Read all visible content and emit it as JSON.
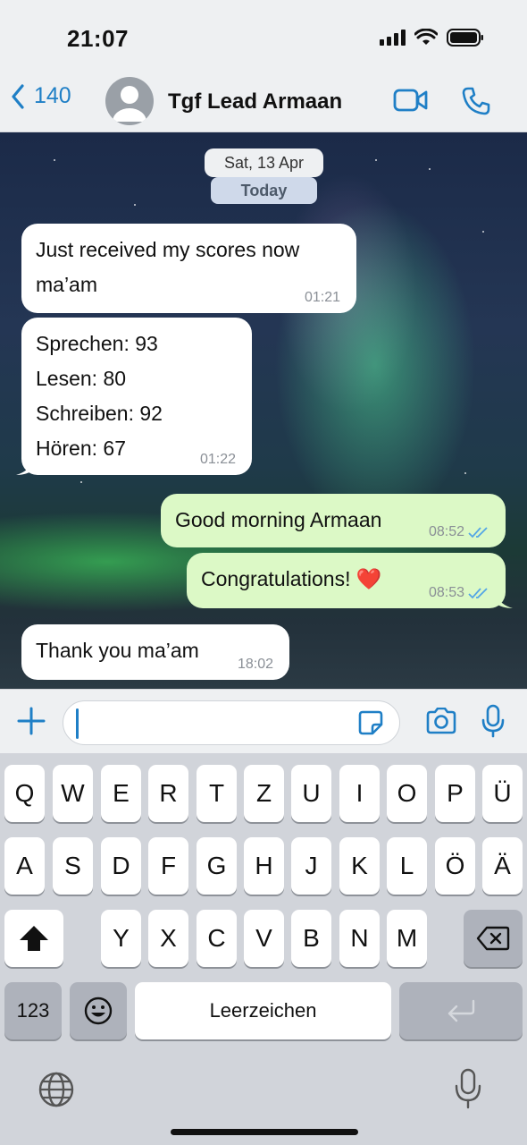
{
  "status": {
    "time": "21:07"
  },
  "nav": {
    "back_count": "140",
    "contact_name": "Tgf Lead Armaan"
  },
  "chat": {
    "date_label": "Sat, 13 Apr",
    "today_label": "Today",
    "messages": [
      {
        "direction": "incoming",
        "lines": [
          "Just received my scores now",
          "ma’am"
        ],
        "time": "01:21"
      },
      {
        "direction": "incoming",
        "lines": [
          "Sprechen: 93",
          "Lesen: 80",
          "Schreiben: 92",
          "Hören: 67"
        ],
        "time": "01:22"
      },
      {
        "direction": "outgoing",
        "lines": [
          "Good morning Armaan"
        ],
        "time": "08:52",
        "status": "read"
      },
      {
        "direction": "outgoing",
        "lines": [
          "Congratulations! ❤️"
        ],
        "time": "08:53",
        "status": "read"
      },
      {
        "direction": "incoming",
        "lines": [
          "Thank you ma’am"
        ],
        "time": "18:02"
      }
    ]
  },
  "input": {
    "value": "",
    "placeholder": ""
  },
  "keyboard": {
    "row1": [
      "Q",
      "W",
      "E",
      "R",
      "T",
      "Z",
      "U",
      "I",
      "O",
      "P",
      "Ü"
    ],
    "row2": [
      "A",
      "S",
      "D",
      "F",
      "G",
      "H",
      "J",
      "K",
      "L",
      "Ö",
      "Ä"
    ],
    "row3": [
      "Y",
      "X",
      "C",
      "V",
      "B",
      "N",
      "M"
    ],
    "numbers_key": "123",
    "space_key": "Leerzeichen"
  },
  "colors": {
    "accent": "#1f7fc6",
    "outgoing_bubble": "#dcf9c6",
    "incoming_bubble": "#ffffff",
    "read_ticks": "#53a6e6"
  },
  "icons": [
    "signal-icon",
    "wifi-icon",
    "battery-icon",
    "chevron-left-icon",
    "avatar-icon",
    "video-call-icon",
    "phone-icon",
    "plus-icon",
    "sticker-icon",
    "camera-icon",
    "microphone-icon",
    "shift-icon",
    "backspace-icon",
    "emoji-icon",
    "return-icon",
    "globe-icon",
    "dictation-icon"
  ]
}
